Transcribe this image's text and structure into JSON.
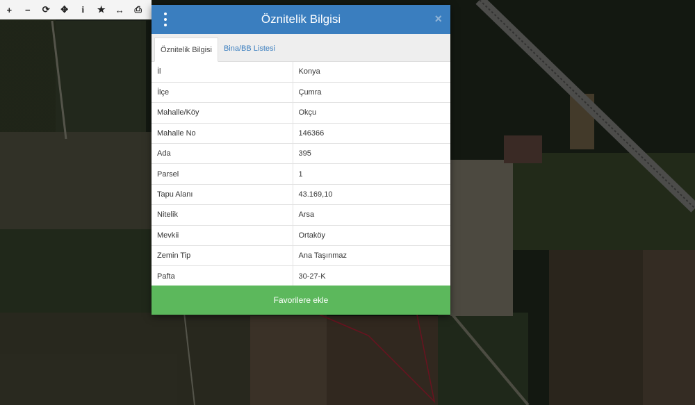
{
  "toolbar": {
    "items": [
      {
        "name": "zoom-in",
        "glyph": "+"
      },
      {
        "name": "zoom-out",
        "glyph": "−"
      },
      {
        "name": "refresh",
        "glyph": "⟳"
      },
      {
        "name": "locate",
        "glyph": "✥"
      },
      {
        "name": "info",
        "glyph": "i"
      },
      {
        "name": "favorite",
        "glyph": "★"
      },
      {
        "name": "measure",
        "glyph": "↔"
      },
      {
        "name": "print",
        "glyph": "⎙"
      }
    ]
  },
  "modal": {
    "title": "Öznitelik Bilgisi",
    "close_glyph": "×",
    "tabs": [
      {
        "label": "Öznitelik Bilgisi",
        "active": true
      },
      {
        "label": "Bina/BB Listesi",
        "active": false
      }
    ],
    "rows": [
      {
        "key": "İl",
        "value": "Konya"
      },
      {
        "key": "İlçe",
        "value": "Çumra"
      },
      {
        "key": "Mahalle/Köy",
        "value": "Okçu"
      },
      {
        "key": "Mahalle No",
        "value": "146366"
      },
      {
        "key": "Ada",
        "value": "395"
      },
      {
        "key": "Parsel",
        "value": "1"
      },
      {
        "key": "Tapu Alanı",
        "value": "43.169,10"
      },
      {
        "key": "Nitelik",
        "value": "Arsa"
      },
      {
        "key": "Mevkii",
        "value": "Ortaköy"
      },
      {
        "key": "Zemin Tip",
        "value": "Ana Taşınmaz"
      },
      {
        "key": "Pafta",
        "value": "30-27-K"
      }
    ],
    "favorite_button": "Favorilere ekle"
  },
  "colors": {
    "header": "#3a7ebf",
    "favorite": "#5cb85c",
    "parcel_outline": "#c0223a"
  }
}
